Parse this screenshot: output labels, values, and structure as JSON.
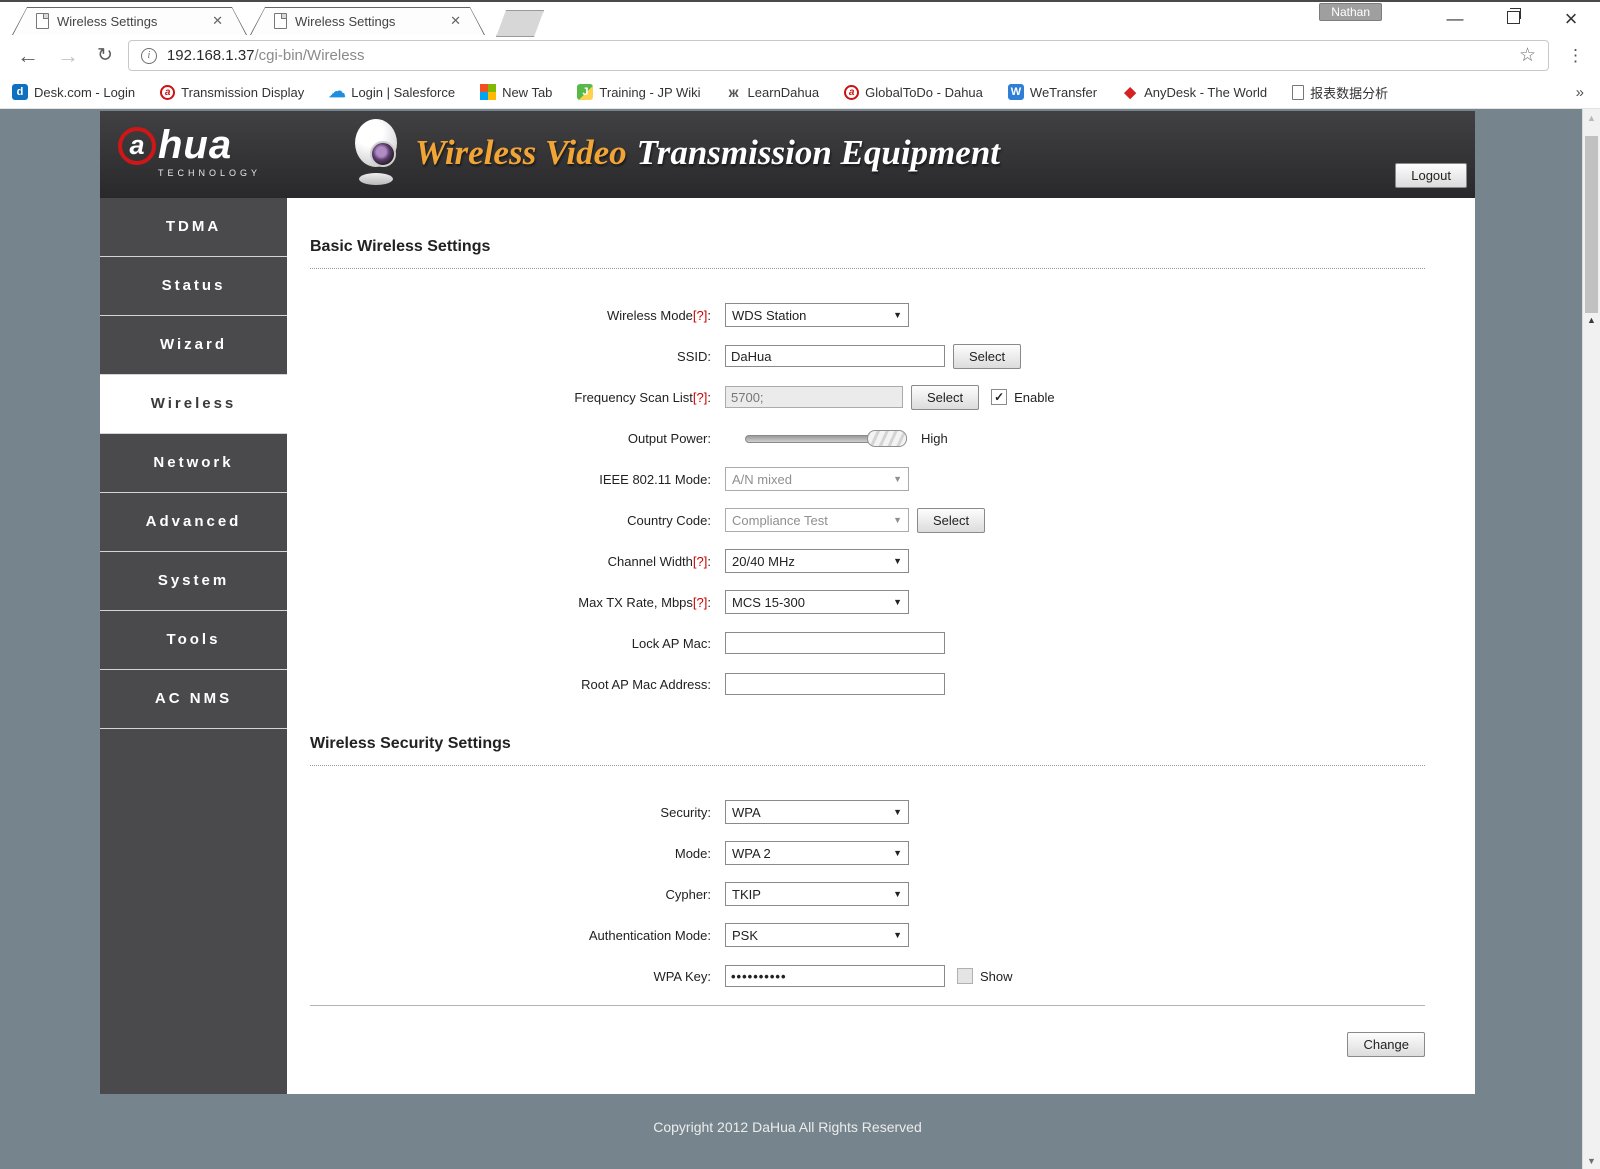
{
  "browser": {
    "tabs": [
      {
        "title": "Wireless Settings"
      },
      {
        "title": "Wireless Settings"
      }
    ],
    "profile_name": "Nathan",
    "url_host": "192.168.1.37",
    "url_path": "/cgi-bin/Wireless",
    "bookmarks": [
      {
        "label": "Desk.com - Login",
        "icon": "desk",
        "glyph": "d"
      },
      {
        "label": "Transmission Display",
        "icon": "dahua",
        "glyph": "a"
      },
      {
        "label": "Login | Salesforce",
        "icon": "cloud",
        "glyph": "☁"
      },
      {
        "label": "New Tab",
        "icon": "msgrid",
        "glyph": ""
      },
      {
        "label": "Training - JP Wiki",
        "icon": "wiki",
        "glyph": "J"
      },
      {
        "label": "LearnDahua",
        "icon": "people",
        "glyph": "ж"
      },
      {
        "label": "GlobalToDo - Dahua",
        "icon": "dahua",
        "glyph": "a"
      },
      {
        "label": "WeTransfer",
        "icon": "wetransfer",
        "glyph": "W"
      },
      {
        "label": "AnyDesk - The World",
        "icon": "diamond",
        "glyph": "◆"
      },
      {
        "label": "报表数据分析",
        "icon": "doc",
        "glyph": ""
      }
    ]
  },
  "icons": {
    "back": "←",
    "forward": "→",
    "reload": "↻",
    "info": "i",
    "star": "☆",
    "menu_dots": "⋮",
    "overflow": "»",
    "tab_close": "✕",
    "minimize": "—",
    "close": "×",
    "dropdown_arrow": "▼",
    "check": "✓",
    "scroll_up": "▲",
    "scroll_down": "▼",
    "scroll_marker": "▲"
  },
  "header": {
    "logo_a": "a",
    "logo_text": "hua",
    "logo_sub": "TECHNOLOGY",
    "title_accent": "Wireless Video",
    "title_rest": "Transmission Equipment",
    "logout_label": "Logout"
  },
  "sidebar": {
    "items": [
      {
        "label": "TDMA",
        "active": false
      },
      {
        "label": "Status",
        "active": false
      },
      {
        "label": "Wizard",
        "active": false
      },
      {
        "label": "Wireless",
        "active": true
      },
      {
        "label": "Network",
        "active": false
      },
      {
        "label": "Advanced",
        "active": false
      },
      {
        "label": "System",
        "active": false
      },
      {
        "label": "Tools",
        "active": false
      },
      {
        "label": "AC NMS",
        "active": false
      }
    ]
  },
  "main": {
    "section_basic": "Basic Wireless Settings",
    "section_security": "Wireless Security Settings",
    "help_marker": "[?]",
    "colon": ":",
    "fields": {
      "wireless_mode": {
        "label": "Wireless Mode",
        "value": "WDS Station"
      },
      "ssid": {
        "label": "SSID:",
        "value": "DaHua",
        "button": "Select"
      },
      "frequency_scan": {
        "label": "Frequency Scan List",
        "value": "5700;",
        "button": "Select",
        "checkbox_label": "Enable",
        "checkbox_checked": true
      },
      "output_power": {
        "label": "Output Power:",
        "value": "High"
      },
      "ieee_mode": {
        "label": "IEEE 802.11 Mode:",
        "value": "A/N mixed"
      },
      "country_code": {
        "label": "Country Code:",
        "value": "Compliance Test",
        "button": "Select"
      },
      "channel_width": {
        "label": "Channel Width",
        "value": "20/40 MHz"
      },
      "max_tx_rate": {
        "label": "Max TX Rate, Mbps",
        "value": "MCS 15-300"
      },
      "lock_ap_mac": {
        "label": "Lock AP Mac:",
        "value": ""
      },
      "root_ap_mac": {
        "label": "Root AP Mac Address:",
        "value": ""
      },
      "security": {
        "label": "Security:",
        "value": "WPA"
      },
      "mode": {
        "label": "Mode:",
        "value": "WPA 2"
      },
      "cypher": {
        "label": "Cypher:",
        "value": "TKIP"
      },
      "auth_mode": {
        "label": "Authentication Mode:",
        "value": "PSK"
      },
      "wpa_key": {
        "label": "WPA Key:",
        "value": "••••••••••",
        "checkbox_label": "Show",
        "checkbox_checked": false
      }
    },
    "change_label": "Change"
  },
  "footer": {
    "copyright": "Copyright 2012 DaHua All Rights Reserved"
  },
  "colors": {
    "page_bg": "#76858d",
    "accent_orange": "#f2a536",
    "brand_red": "#cf1717",
    "help_red": "#cc0000",
    "sidebar_bg": "#4a4a4c"
  }
}
